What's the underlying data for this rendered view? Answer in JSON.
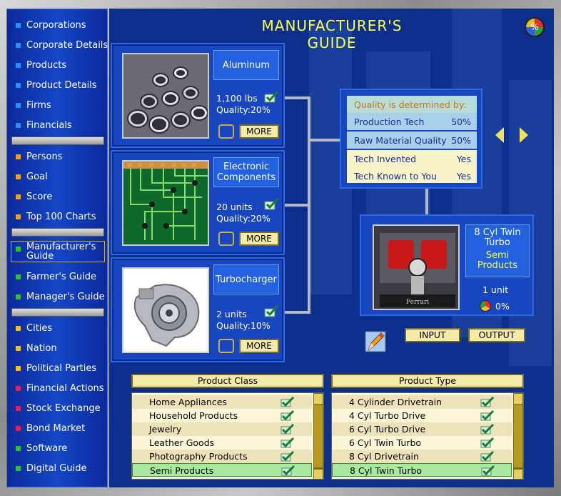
{
  "title": "MANUFACTURER'S GUIDE",
  "help_icon": "%",
  "sidebar": {
    "items": [
      {
        "label": "Corporations",
        "color": "#2a8cff"
      },
      {
        "label": "Corporate Details",
        "color": "#2a8cff"
      },
      {
        "label": "Products",
        "color": "#2a8cff"
      },
      {
        "label": "Product Details",
        "color": "#2a8cff"
      },
      {
        "label": "Firms",
        "color": "#2a8cff"
      },
      {
        "label": "Financials",
        "color": "#2a8cff"
      },
      {
        "label": "Persons",
        "color": "#f0a020"
      },
      {
        "label": "Goal",
        "color": "#f0a020"
      },
      {
        "label": "Score",
        "color": "#f0a020"
      },
      {
        "label": "Top 100 Charts",
        "color": "#f0a020"
      },
      {
        "label": "Manufacturer's Guide",
        "color": "#30c030"
      },
      {
        "label": "Farmer's Guide",
        "color": "#30c030"
      },
      {
        "label": "Manager's Guide",
        "color": "#30c030"
      },
      {
        "label": "Cities",
        "color": "#f0c020"
      },
      {
        "label": "Nation",
        "color": "#f0c020"
      },
      {
        "label": "Political Parties",
        "color": "#f0c020"
      },
      {
        "label": "Financial Actions",
        "color": "#e02060"
      },
      {
        "label": "Stock Exchange",
        "color": "#e02060"
      },
      {
        "label": "Bond Market",
        "color": "#e02060"
      },
      {
        "label": "Software",
        "color": "#30c030"
      },
      {
        "label": "Digital Guide",
        "color": "#30c030"
      }
    ]
  },
  "materials": [
    {
      "name": "Aluminum",
      "qty": "1,100 lbs",
      "quality": "Quality:20%",
      "more": "MORE",
      "image": "aluminum-pipes"
    },
    {
      "name": "Electronic Components",
      "qty": "20 units",
      "quality": "Quality:20%",
      "more": "MORE",
      "image": "circuit-board"
    },
    {
      "name": "Turbocharger",
      "qty": "2 units",
      "quality": "Quality:10%",
      "more": "MORE",
      "image": "turbocharger"
    }
  ],
  "quality_panel": {
    "header": "Quality is determined by:",
    "rows": [
      {
        "label": "Production Tech",
        "value": "50%"
      },
      {
        "label": "Raw Material Quality",
        "value": "50%"
      },
      {
        "label": "Tech Invented",
        "value": "Yes"
      },
      {
        "label": "Tech Known to You",
        "value": "Yes"
      }
    ]
  },
  "product": {
    "name": "8 Cyl Twin Turbo",
    "class": "Semi Products",
    "qty": "1 unit",
    "pct": "0%",
    "image": "engine"
  },
  "buttons": {
    "input": "INPUT",
    "output": "OUTPUT"
  },
  "product_class": {
    "header": "Product Class",
    "items": [
      "Home Appliances",
      "Household Products",
      "Jewelry",
      "Leather Goods",
      "Photography Products",
      "Semi Products"
    ],
    "selected": "Semi Products"
  },
  "product_type": {
    "header": "Product Type",
    "items": [
      "4 Cylinder Drivetrain",
      "4 Cyl Turbo Drive",
      "6 Cyl Turbo Drive",
      "6 Cyl Twin Turbo",
      "8 Cyl Drivetrain",
      "8 Cyl Twin Turbo"
    ],
    "selected": "8 Cyl Twin Turbo"
  },
  "colors": {
    "accent_yellow": "#ffff44",
    "panel_blue": "#1846c0",
    "button_cream": "#f4eba8"
  }
}
